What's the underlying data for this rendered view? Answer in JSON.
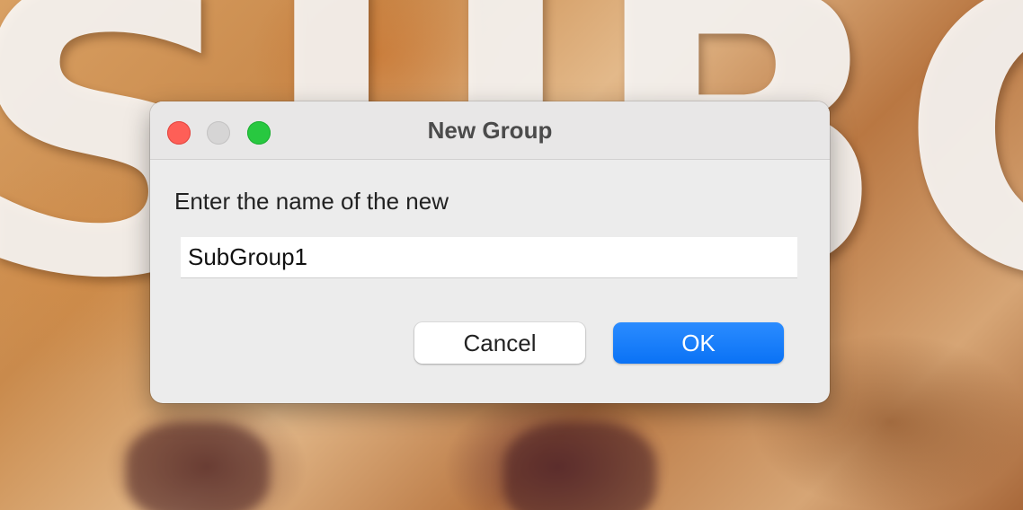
{
  "dialog": {
    "title": "New Group",
    "prompt": "Enter the name of the new",
    "name_value": "SubGroup1",
    "cancel_label": "Cancel",
    "ok_label": "OK"
  },
  "background": {
    "text": "SUBCONTR"
  },
  "colors": {
    "accent": "#0a72f5",
    "close": "#fe5f57",
    "minimize": "#d6d5d5",
    "zoom": "#28c840"
  }
}
